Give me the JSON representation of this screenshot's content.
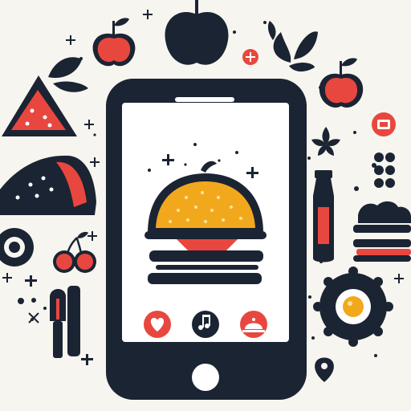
{
  "palette": {
    "background": "#f7f5ef",
    "navy": "#1b2433",
    "red": "#e8473f",
    "orange": "#f2a81d",
    "white": "#ffffff"
  },
  "phone": {
    "screen_items": [
      "burger-icon"
    ],
    "buttons": [
      {
        "name": "heart-button",
        "icon": "heart-icon"
      },
      {
        "name": "music-button",
        "icon": "music-note-icon"
      },
      {
        "name": "dish-button",
        "icon": "cloche-icon"
      }
    ],
    "home_button_icon": "home-button-icon"
  },
  "surrounding_icons": [
    "apple-icon",
    "dark-apple-icon",
    "leaves-icon",
    "watermelon-icon",
    "taco-icon",
    "cherries-icon",
    "sauce-bottle-icon",
    "sandwich-icon",
    "fried-egg-icon",
    "spatula-icon",
    "flower-icon",
    "location-pin-icon"
  ]
}
